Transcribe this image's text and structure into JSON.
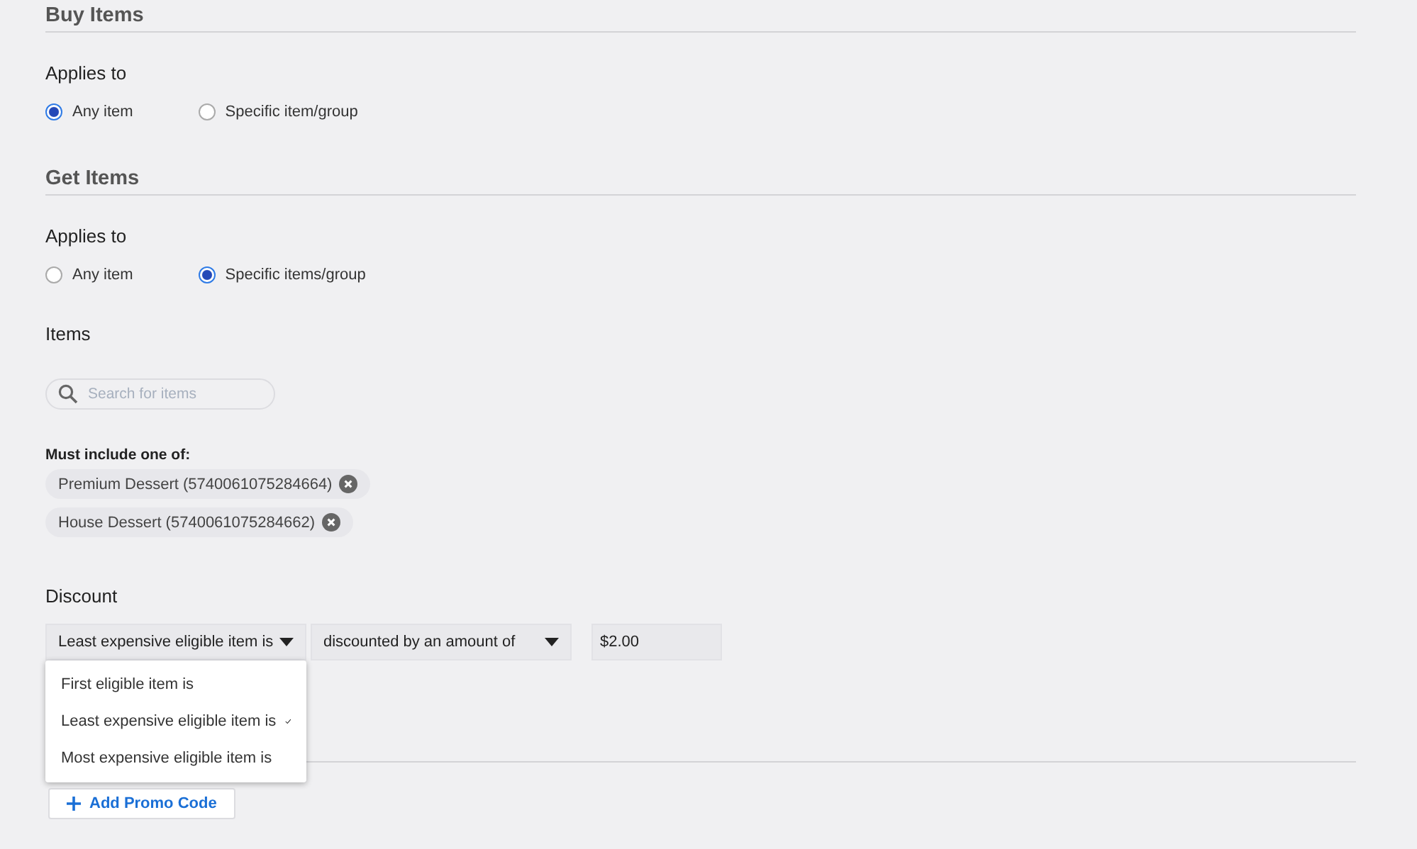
{
  "sections": [
    {
      "title": "Buy Items",
      "applies_label": "Applies to",
      "options": [
        {
          "label": "Any item",
          "selected": true
        },
        {
          "label": "Specific item/group",
          "selected": false
        }
      ]
    },
    {
      "title": "Get Items",
      "applies_label": "Applies to",
      "options": [
        {
          "label": "Any item",
          "selected": false
        },
        {
          "label": "Specific items/group",
          "selected": true
        }
      ]
    }
  ],
  "items": {
    "label": "Items",
    "search": {
      "placeholder": "Search for items"
    },
    "must_include_label": "Must include one of:",
    "chips": [
      {
        "label": "Premium Dessert (5740061075284664)"
      },
      {
        "label": "House Dessert (5740061075284662)"
      }
    ]
  },
  "discount": {
    "label": "Discount",
    "target_dropdown": {
      "value": "Least expensive eligible item is",
      "expanded": true,
      "options": [
        {
          "label": "First eligible item is",
          "selected": false
        },
        {
          "label": "Least expensive eligible item is",
          "selected": true
        },
        {
          "label": "Most expensive eligible item is",
          "selected": false
        }
      ]
    },
    "type_dropdown": {
      "value": "discounted by an amount of"
    },
    "amount": {
      "value": "$2.00"
    }
  },
  "add_promo_button": {
    "label": "Add Promo Code"
  }
}
